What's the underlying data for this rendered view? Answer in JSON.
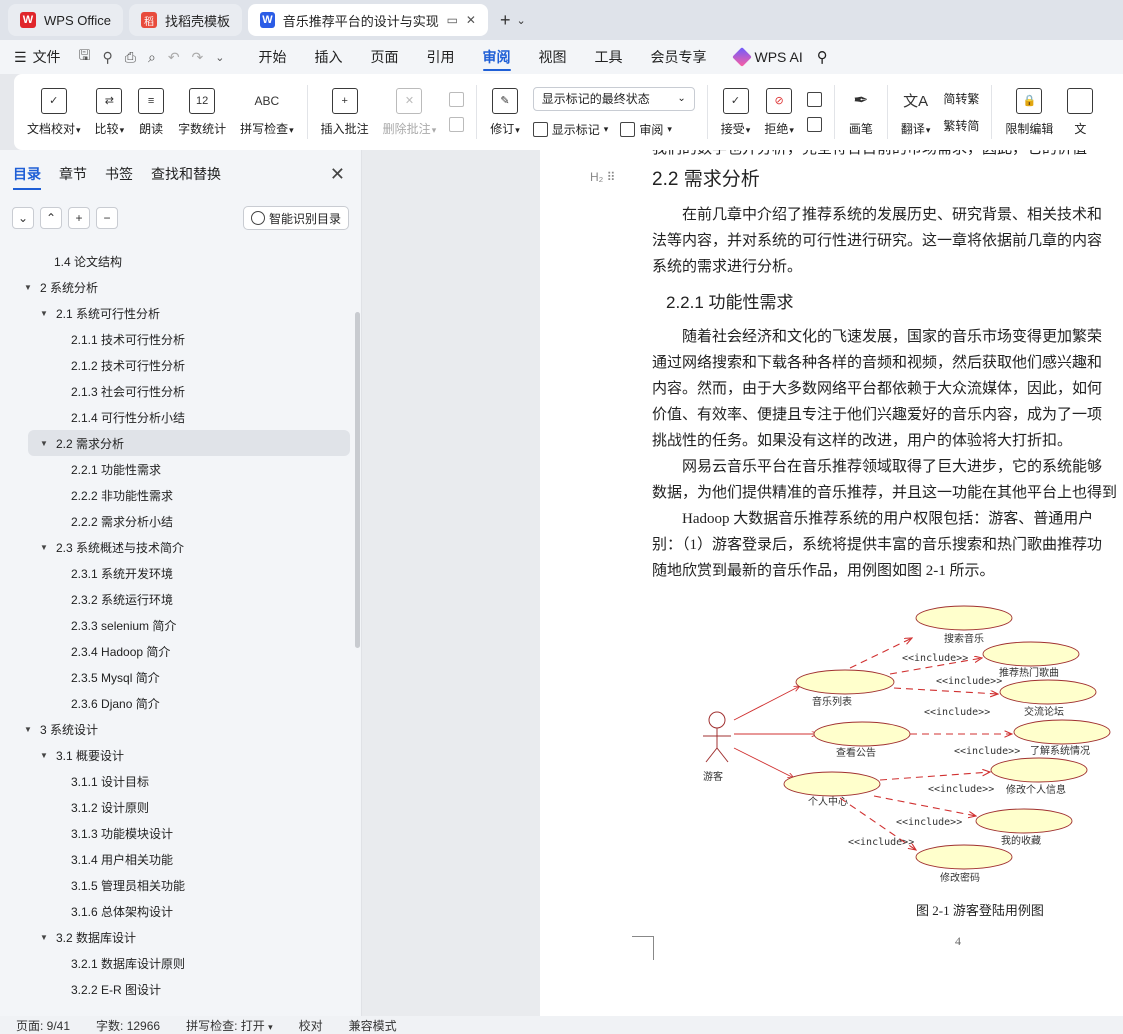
{
  "tabs": [
    {
      "label": "WPS Office",
      "icon": "wps-logo-icon"
    },
    {
      "label": "找稻壳模板",
      "icon": "docer-logo-icon"
    },
    {
      "label": "音乐推荐平台的设计与实现 毕",
      "icon": "doc-logo-icon"
    }
  ],
  "menubar": {
    "file": "文件",
    "items": [
      "开始",
      "插入",
      "页面",
      "引用",
      "审阅",
      "视图",
      "工具",
      "会员专享"
    ],
    "active": "审阅",
    "ai": "WPS AI"
  },
  "ribbon": {
    "doc_check": "文档校对",
    "compare": "比较",
    "read_aloud": "朗读",
    "word_count": "字数统计",
    "word_count_icon": "12",
    "spell_check": "拼写检查",
    "spell_icon": "ABC",
    "insert_comment": "插入批注",
    "delete_comment": "删除批注",
    "revise": "修订",
    "markup_dropdown": "显示标记的最终状态",
    "show_markup": "显示标记",
    "review": "审阅",
    "accept": "接受",
    "reject": "拒绝",
    "pen": "画笔",
    "translate": "翻译",
    "to_traditional": "简转繁",
    "to_simplified": "繁转简",
    "restrict_edit": "限制编辑",
    "doc_truncated": "文"
  },
  "nav": {
    "tabs": [
      "目录",
      "章节",
      "书签",
      "查找和替换"
    ],
    "active_tab": "目录",
    "smart_toc": "智能识别目录",
    "toc": [
      {
        "label": "1.4  论文结构",
        "level": 2,
        "arrow": ""
      },
      {
        "label": "2  系统分析",
        "level": 1,
        "arrow": "▼"
      },
      {
        "label": "2.1 系统可行性分析",
        "level": 2,
        "arrow": "▼"
      },
      {
        "label": "2.1.1  技术可行性分析",
        "level": 3,
        "arrow": ""
      },
      {
        "label": "2.1.2  技术可行性分析",
        "level": 3,
        "arrow": ""
      },
      {
        "label": "2.1.3  社会可行性分析",
        "level": 3,
        "arrow": ""
      },
      {
        "label": "2.1.4  可行性分析小结",
        "level": 3,
        "arrow": ""
      },
      {
        "label": "2.2 需求分析",
        "level": 2,
        "arrow": "▼",
        "selected": true
      },
      {
        "label": "2.2.1  功能性需求",
        "level": 3,
        "arrow": ""
      },
      {
        "label": "2.2.2  非功能性需求",
        "level": 3,
        "arrow": ""
      },
      {
        "label": "2.2.2  需求分析小结",
        "level": 3,
        "arrow": ""
      },
      {
        "label": "2.3 系统概述与技术简介",
        "level": 2,
        "arrow": "▼"
      },
      {
        "label": "2.3.1 系统开发环境",
        "level": 3,
        "arrow": ""
      },
      {
        "label": "2.3.2 系统运行环境",
        "level": 3,
        "arrow": ""
      },
      {
        "label": "2.3.3 selenium 简介",
        "level": 3,
        "arrow": ""
      },
      {
        "label": "2.3.4 Hadoop 简介",
        "level": 3,
        "arrow": ""
      },
      {
        "label": "2.3.5 Mysql 简介",
        "level": 3,
        "arrow": ""
      },
      {
        "label": "2.3.6 Djano 简介",
        "level": 3,
        "arrow": ""
      },
      {
        "label": "3 系统设计",
        "level": 1,
        "arrow": "▼"
      },
      {
        "label": "3.1  概要设计",
        "level": 2,
        "arrow": "▼"
      },
      {
        "label": "3.1.1 设计目标",
        "level": 3,
        "arrow": ""
      },
      {
        "label": "3.1.2  设计原则",
        "level": 3,
        "arrow": ""
      },
      {
        "label": "3.1.3  功能模块设计",
        "level": 3,
        "arrow": ""
      },
      {
        "label": "3.1.4  用户相关功能",
        "level": 3,
        "arrow": ""
      },
      {
        "label": "3.1.5  管理员相关功能",
        "level": 3,
        "arrow": ""
      },
      {
        "label": "3.1.6  总体架构设计",
        "level": 3,
        "arrow": ""
      },
      {
        "label": "3.2  数据库设计",
        "level": 2,
        "arrow": "▼"
      },
      {
        "label": "3.2.1 数据库设计原则",
        "level": 3,
        "arrow": ""
      },
      {
        "label": "3.2.2 E-R 图设计",
        "level": 3,
        "arrow": ""
      }
    ]
  },
  "doc": {
    "top_cut": "我们的数学也并分析，完全符合目前的市场需求，因此，它的价值",
    "heading": "2.2 需求分析",
    "para1": [
      "　　在前几章中介绍了推荐系统的发展历史、研究背景、相关技术和",
      "法等内容，并对系统的可行性进行研究。这一章将依据前几章的内容",
      "系统的需求进行分析。"
    ],
    "subheading": "2.2.1  功能性需求",
    "para2": [
      "　　随着社会经济和文化的飞速发展，国家的音乐市场变得更加繁荣",
      "通过网络搜索和下载各种各样的音频和视频，然后获取他们感兴趣和",
      "内容。然而，由于大多数网络平台都依赖于大众流媒体，因此，如何",
      "价值、有效率、便捷且专注于他们兴趣爱好的音乐内容，成为了一项",
      "挑战性的任务。如果没有这样的改进，用户的体验将大打折扣。",
      "　　网易云音乐平台在音乐推荐领域取得了巨大进步，它的系统能够",
      "数据，为他们提供精准的音乐推荐，并且这一功能在其他平台上也得到",
      "　　Hadoop 大数据音乐推荐系统的用户权限包括：游客、普通用户",
      "别：（1）游客登录后，系统将提供丰富的音乐搜索和热门歌曲推荐功",
      "随地欣赏到最新的音乐作品，用例图如图 2-1 所示。"
    ],
    "figure": {
      "actor": "游客",
      "mid": [
        "音乐列表",
        "查看公告",
        "个人中心"
      ],
      "right": [
        "搜索音乐",
        "推荐热门歌曲",
        "交流论坛",
        "了解系统情况",
        "修改个人信息",
        "我的收藏",
        "修改密码"
      ],
      "include": "<<include>>"
    },
    "caption": "图 2-1 游客登陆用例图",
    "page_number": "4",
    "heading_marker": "H₂"
  },
  "status": {
    "page": "页面: 9/41",
    "words": "字数: 12966",
    "spell": "拼写检查: 打开",
    "proof": "校对",
    "compat": "兼容模式"
  },
  "colors": {
    "accent": "#1f5fd6",
    "uml_fill": "#ffffcc",
    "uml_stroke": "#a03030",
    "uml_arrow": "#d03030"
  }
}
